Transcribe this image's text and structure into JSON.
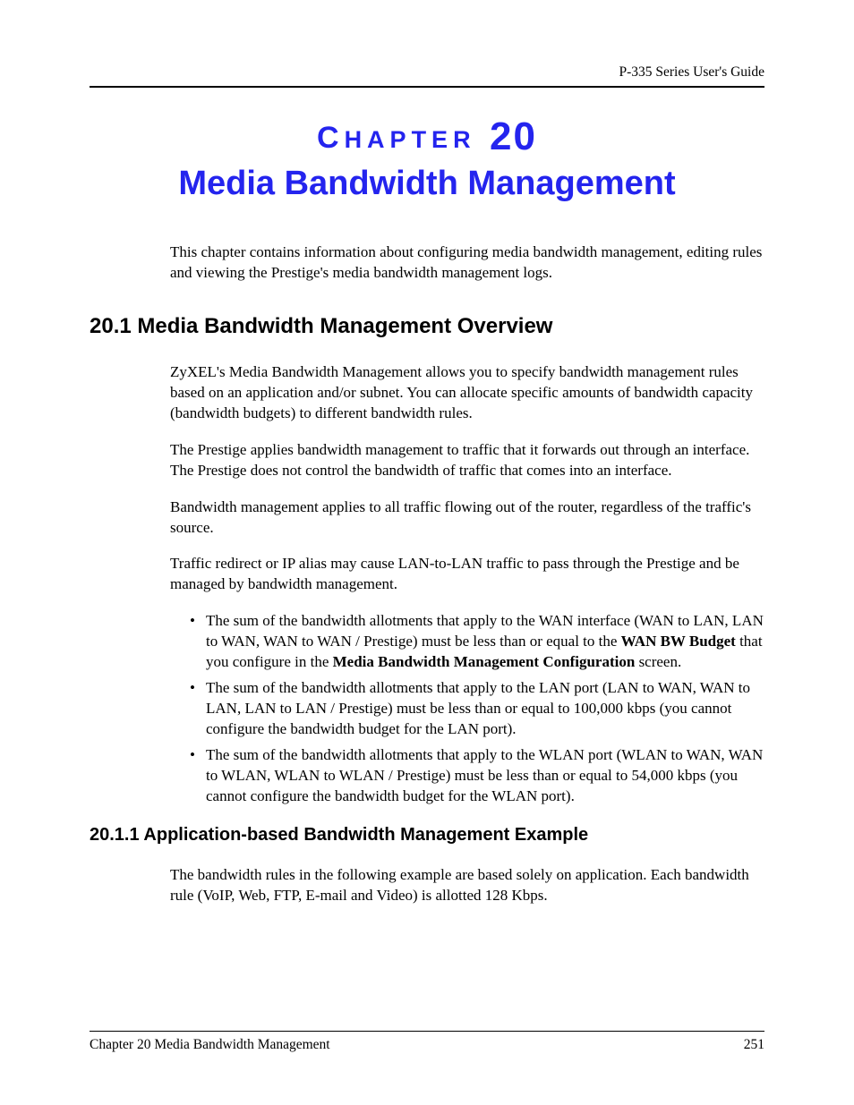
{
  "header": {
    "guide_title": "P-335 Series User's Guide"
  },
  "chapter": {
    "label_prefix": "CHAPTER",
    "label_word": "C",
    "label_rest": "HAPTER",
    "number": "20",
    "title": "Media Bandwidth Management",
    "intro": "This chapter contains information about configuring media bandwidth management, editing rules and viewing the Prestige's media bandwidth management logs."
  },
  "section_20_1": {
    "heading": "20.1  Media Bandwidth Management Overview",
    "paras": [
      "ZyXEL's Media Bandwidth Management allows you to specify bandwidth management rules based on an application and/or subnet. You can allocate specific amounts of bandwidth capacity (bandwidth budgets) to different bandwidth rules.",
      "The Prestige applies bandwidth management to traffic that it forwards out through an interface. The Prestige does not control the bandwidth of traffic that comes into an interface.",
      "Bandwidth management applies to all traffic flowing out of the router, regardless of the traffic's source.",
      "Traffic redirect or IP alias may cause LAN-to-LAN traffic to pass through the Prestige and be managed by bandwidth management."
    ],
    "bullets": [
      {
        "pre": "The sum of the bandwidth allotments that apply to the WAN interface (WAN to LAN, LAN to WAN, WAN to WAN / Prestige) must be less than or equal to the ",
        "bold1": "WAN BW Budget",
        "mid": " that you configure in the ",
        "bold2": "Media Bandwidth Management Configuration",
        "post": " screen."
      },
      {
        "text": "The sum of the bandwidth allotments that apply to the LAN port (LAN to WAN, WAN to LAN, LAN to LAN / Prestige) must be less than or equal to 100,000 kbps (you cannot configure the bandwidth budget for the LAN port)."
      },
      {
        "text": "The sum of the bandwidth allotments that apply to the WLAN port (WLAN to WAN, WAN to WLAN, WLAN to WLAN / Prestige) must be less than or equal to 54,000 kbps (you cannot configure the bandwidth budget for the WLAN port)."
      }
    ]
  },
  "section_20_1_1": {
    "heading": "20.1.1  Application-based Bandwidth Management Example",
    "para": "The bandwidth rules in the following example are based solely on application. Each bandwidth rule (VoIP, Web, FTP, E-mail and Video) is allotted 128 Kbps."
  },
  "footer": {
    "left": "Chapter 20 Media Bandwidth Management",
    "right": "251"
  }
}
